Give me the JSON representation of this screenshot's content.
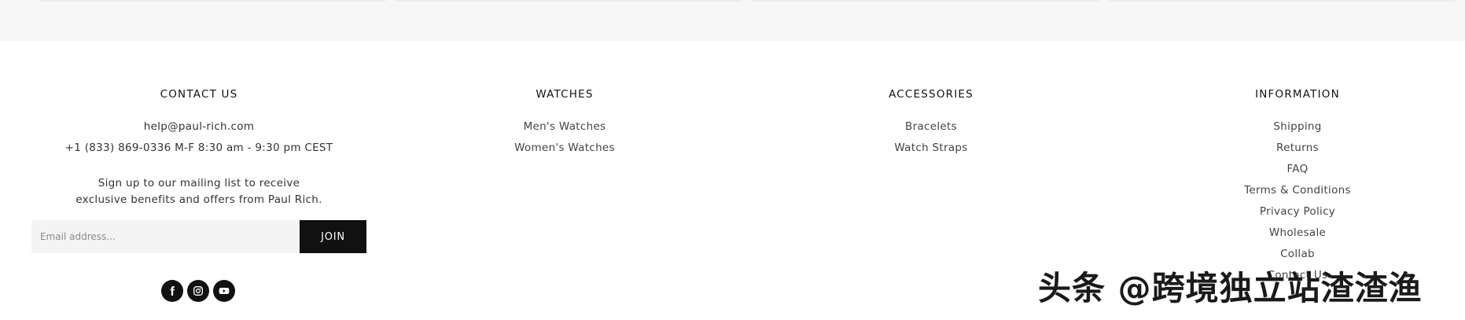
{
  "contact": {
    "title": "CONTACT US",
    "email": "help@paul-rich.com",
    "phone": "+1 (833) 869-0336 M-F 8:30 am - 9:30 pm CEST",
    "signup_line1": "Sign up to our mailing list to receive",
    "signup_line2": "exclusive benefits and offers from Paul Rich.",
    "email_placeholder": "Email address...",
    "join_label": "JOIN"
  },
  "social": [
    "facebook-icon",
    "instagram-icon",
    "youtube-icon"
  ],
  "watches": {
    "title": "WATCHES",
    "links": [
      "Men's Watches",
      "Women's Watches"
    ]
  },
  "accessories": {
    "title": "ACCESSORIES",
    "links": [
      "Bracelets",
      "Watch Straps"
    ]
  },
  "information": {
    "title": "INFORMATION",
    "links": [
      "Shipping",
      "Returns",
      "FAQ",
      "Terms & Conditions",
      "Privacy Policy",
      "Wholesale",
      "Collab",
      "Contact Us"
    ]
  },
  "watermark": "头条 @跨境独立站渣渣渔",
  "colors": {
    "button": "#111111",
    "band": "#f7f7f7"
  }
}
